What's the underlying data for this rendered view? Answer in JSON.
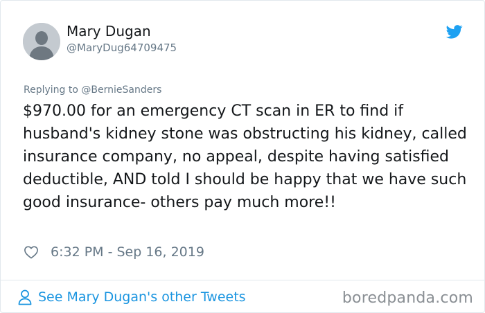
{
  "tweet": {
    "author_name": "Mary Dugan",
    "author_handle": "@MaryDug64709475",
    "replying_to": "Replying to @BernieSanders",
    "text": "$970.00 for an emergency CT scan in ER to find if husband's kidney stone was obstructing his kidney, called insurance company, no appeal, despite having satisfied deductible, AND told I should be happy that we have such good insurance- others pay much more!!",
    "timestamp": "6:32 PM - Sep 16, 2019"
  },
  "footer": {
    "see_more_label": "See Mary Dugan's other Tweets",
    "watermark": "boredpanda.com"
  },
  "icons": {
    "brand": "twitter-bird-icon",
    "like": "heart-icon",
    "profile": "person-icon"
  },
  "colors": {
    "twitter_blue": "#1da1f2",
    "link_blue": "#1b95e0",
    "text": "#14171a",
    "secondary_text": "#657786",
    "avatar_bg": "#c4cad0",
    "border": "#e1e8ed"
  }
}
